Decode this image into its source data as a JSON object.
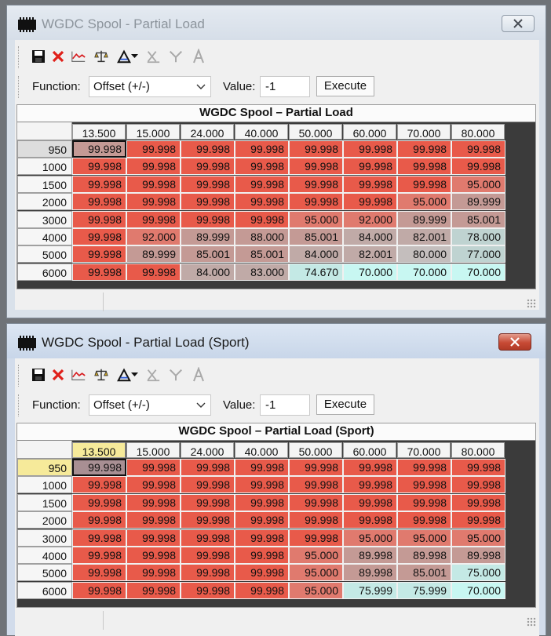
{
  "windows": [
    {
      "title": "WGDC Spool - Partial Load",
      "function_label": "Function:",
      "function_value": "Offset (+/-)",
      "value_label": "Value:",
      "value_input": "-1",
      "execute_label": "Execute",
      "grid": {
        "title": "WGDC Spool – Partial Load",
        "columns": [
          "13.500",
          "15.000",
          "24.000",
          "40.000",
          "50.000",
          "60.000",
          "70.000",
          "80.000"
        ],
        "rows": [
          "950",
          "1000",
          "1500",
          "2000",
          "3000",
          "4000",
          "5000",
          "6000"
        ],
        "values": [
          [
            "99.998",
            "99.998",
            "99.998",
            "99.998",
            "99.998",
            "99.998",
            "99.998",
            "99.998"
          ],
          [
            "99.998",
            "99.998",
            "99.998",
            "99.998",
            "99.998",
            "99.998",
            "99.998",
            "99.998"
          ],
          [
            "99.998",
            "99.998",
            "99.998",
            "99.998",
            "99.998",
            "99.998",
            "99.998",
            "95.000"
          ],
          [
            "99.998",
            "99.998",
            "99.998",
            "99.998",
            "99.998",
            "99.998",
            "95.000",
            "89.999"
          ],
          [
            "99.998",
            "99.998",
            "99.998",
            "99.998",
            "95.000",
            "92.000",
            "89.999",
            "85.001"
          ],
          [
            "99.998",
            "92.000",
            "89.999",
            "88.000",
            "85.001",
            "84.000",
            "82.001",
            "78.000"
          ],
          [
            "99.998",
            "89.999",
            "85.001",
            "85.001",
            "84.000",
            "82.001",
            "80.000",
            "77.000"
          ],
          [
            "99.998",
            "99.998",
            "84.000",
            "83.000",
            "74.670",
            "70.000",
            "70.000",
            "70.000"
          ]
        ]
      }
    },
    {
      "title": "WGDC Spool - Partial Load (Sport)",
      "function_label": "Function:",
      "function_value": "Offset (+/-)",
      "value_label": "Value:",
      "value_input": "-1",
      "execute_label": "Execute",
      "grid": {
        "title": "WGDC Spool – Partial Load (Sport)",
        "columns": [
          "13.500",
          "15.000",
          "24.000",
          "40.000",
          "50.000",
          "60.000",
          "70.000",
          "80.000"
        ],
        "rows": [
          "950",
          "1000",
          "1500",
          "2000",
          "3000",
          "4000",
          "5000",
          "6000"
        ],
        "values": [
          [
            "99.998",
            "99.998",
            "99.998",
            "99.998",
            "99.998",
            "99.998",
            "99.998",
            "99.998"
          ],
          [
            "99.998",
            "99.998",
            "99.998",
            "99.998",
            "99.998",
            "99.998",
            "99.998",
            "99.998"
          ],
          [
            "99.998",
            "99.998",
            "99.998",
            "99.998",
            "99.998",
            "99.998",
            "99.998",
            "99.998"
          ],
          [
            "99.998",
            "99.998",
            "99.998",
            "99.998",
            "99.998",
            "99.998",
            "99.998",
            "99.998"
          ],
          [
            "99.998",
            "99.998",
            "99.998",
            "99.998",
            "99.998",
            "95.000",
            "95.000",
            "95.000"
          ],
          [
            "99.998",
            "99.998",
            "99.998",
            "99.998",
            "95.000",
            "89.998",
            "89.998",
            "89.998"
          ],
          [
            "99.998",
            "99.998",
            "99.998",
            "99.998",
            "95.000",
            "89.998",
            "85.001",
            "75.000"
          ],
          [
            "99.998",
            "99.998",
            "99.998",
            "99.998",
            "95.000",
            "75.999",
            "75.999",
            "70.000"
          ]
        ]
      }
    }
  ],
  "icons": [
    "save-icon",
    "delete-icon",
    "graph-icon",
    "compare-icon",
    "tools-icon",
    "dropdown-arrow-icon",
    "axis-icon",
    "merge-icon",
    "font-icon"
  ],
  "colors": {
    "cell_high": "#e85a4a",
    "cell_mid": "#c49a95",
    "cell_low": "#c8f7f2",
    "header_selected": "#f6ea9a",
    "title_close_active": "#c74a35"
  }
}
